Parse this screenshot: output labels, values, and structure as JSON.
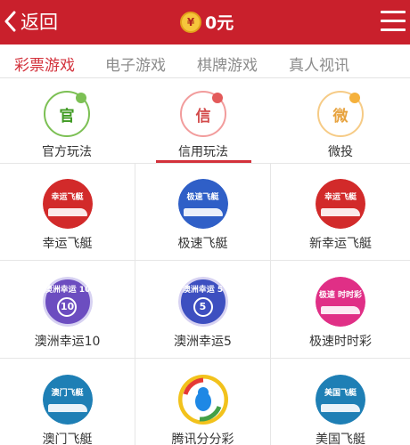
{
  "header": {
    "back_label": "返回",
    "balance": "0元",
    "coin_symbol": "¥"
  },
  "tabs": [
    {
      "label": "彩票游戏",
      "active": true
    },
    {
      "label": "电子游戏"
    },
    {
      "label": "棋牌游戏"
    },
    {
      "label": "真人视讯"
    }
  ],
  "modes": [
    {
      "label": "官方玩法",
      "glyph": "官",
      "color": "#3f9a22",
      "ring": "#7cc054",
      "dot": "#7cc054"
    },
    {
      "label": "信用玩法",
      "glyph": "信",
      "color": "#d34a4a",
      "ring": "#f29c9c",
      "dot": "#e35a5a",
      "active": true
    },
    {
      "label": "微投",
      "glyph": "微",
      "color": "#e7a23d",
      "ring": "#f6cb86",
      "dot": "#f5b13c"
    }
  ],
  "games": [
    {
      "name": "幸运飞艇",
      "icon": "boat-red-icon",
      "bg": "#d22a2a",
      "text": "幸运飞艇"
    },
    {
      "name": "极速飞艇",
      "icon": "boat-blue-icon",
      "bg": "#2f5fc7",
      "text": "极速飞艇"
    },
    {
      "name": "新幸运飞艇",
      "icon": "boat-red-new-icon",
      "bg": "#d22a2a",
      "text": "幸运飞艇"
    },
    {
      "name": "澳洲幸运10",
      "icon": "ball-10-icon",
      "bg": "#6c4dc0",
      "text": "澳洲幸运 10"
    },
    {
      "name": "澳洲幸运5",
      "icon": "ball-5-icon",
      "bg": "#3d4fc0",
      "text": "澳洲幸运 5"
    },
    {
      "name": "极速时时彩",
      "icon": "lottery-pink-icon",
      "bg": "#e02f86",
      "text": "极速 时时彩"
    },
    {
      "name": "澳门飞艇",
      "icon": "boat-macau-icon",
      "bg": "#1e7fb5",
      "text": "澳门飞艇"
    },
    {
      "name": "腾讯分分彩",
      "icon": "tencent-icon",
      "bg": "#ffffff",
      "text": ""
    },
    {
      "name": "美国飞艇",
      "icon": "boat-usa-icon",
      "bg": "#1e7fb5",
      "text": "美国飞艇"
    }
  ]
}
